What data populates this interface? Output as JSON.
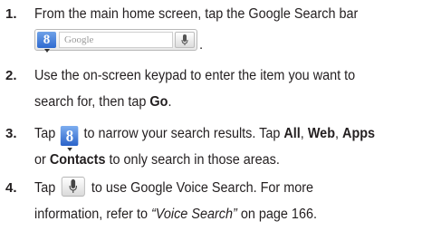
{
  "steps": [
    {
      "number": "1.",
      "line1": "From the main home screen, tap the Google Search bar",
      "searchbar_placeholder": "Google",
      "trailing": "."
    },
    {
      "number": "2.",
      "line1": "Use the on-screen keypad to enter the item you want to",
      "line2_pre": "search for, then tap ",
      "line2_bold": "Go",
      "line2_post": "."
    },
    {
      "number": "3.",
      "line1_pre": "Tap ",
      "line1_post": " to narrow your search results. Tap ",
      "opt_all": "All",
      "sep1": ", ",
      "opt_web": "Web",
      "sep2": ", ",
      "opt_apps": "Apps",
      "line2_pre": "or ",
      "opt_contacts": "Contacts",
      "line2_post": " to only search in those areas."
    },
    {
      "number": "4.",
      "line1_pre": "Tap ",
      "line1_post": " to use Google Voice Search. For more",
      "line2_pre": "information, refer to ",
      "line2_ref": "“Voice Search”",
      "line2_post": " on page 166."
    }
  ],
  "icons": {
    "google_g_glyph": "8",
    "google_g_icon": "google-search-icon",
    "mic_icon": "microphone-icon"
  },
  "colors": {
    "text": "#231f20",
    "google_blue": "#2f6ad0"
  }
}
